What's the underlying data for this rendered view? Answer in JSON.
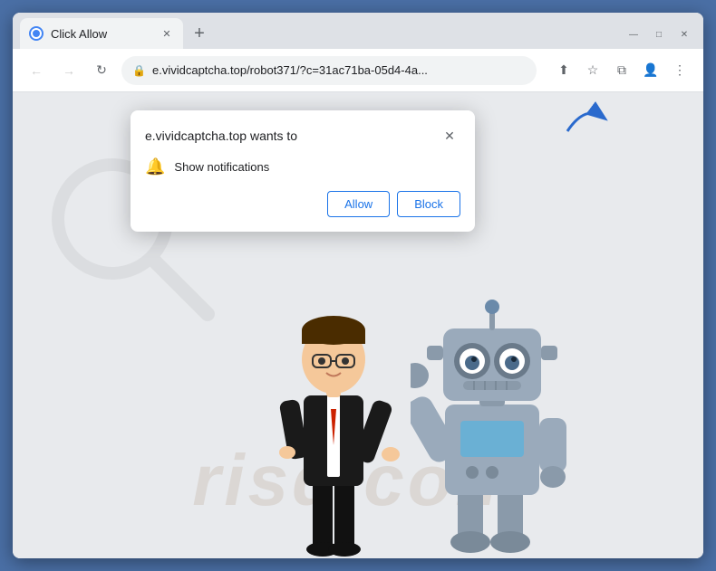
{
  "window": {
    "title": "Click Allow",
    "controls": {
      "minimize": "—",
      "maximize": "□",
      "close": "✕"
    }
  },
  "browser": {
    "nav": {
      "back": "←",
      "forward": "→",
      "reload": "↻"
    },
    "url": "e.vividcaptcha.top/robot371/?c=31ac71ba-05d4-4a...",
    "url_actions": {
      "share": "⬆",
      "bookmark": "☆",
      "split": "⧉",
      "profile": "👤",
      "menu": "⋮"
    }
  },
  "popup": {
    "title": "e.vividcaptcha.top wants to",
    "notification_label": "Show notifications",
    "close_icon": "✕",
    "allow_label": "Allow",
    "block_label": "Block"
  },
  "page": {
    "watermark": "risq.com"
  }
}
